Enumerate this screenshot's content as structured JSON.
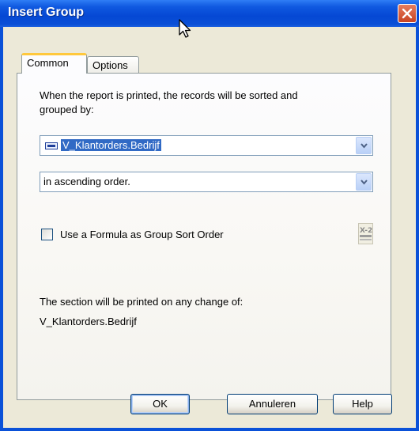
{
  "window": {
    "title": "Insert Group"
  },
  "tabs": [
    {
      "label": "Common",
      "active": true
    },
    {
      "label": "Options",
      "active": false
    }
  ],
  "common": {
    "instruction_line1": "When the report is printed, the records will be sorted and",
    "instruction_line2": "grouped by:",
    "group_field": {
      "value": "V_Klantorders.Bedrijf",
      "icon": "database-field-icon"
    },
    "sort_order": {
      "value": "in ascending order."
    },
    "formula_checkbox": {
      "label": "Use a Formula as Group Sort Order",
      "checked": false
    },
    "formula_button": {
      "icon": "formula-editor-icon",
      "glyph": "X-2"
    },
    "section_info_line1": "The section will be printed on any change of:",
    "section_info_line2": "V_Klantorders.Bedrijf"
  },
  "buttons": {
    "ok": "OK",
    "cancel": "Annuleren",
    "help": "Help"
  },
  "colors": {
    "titlebar": "#0548d4",
    "selection": "#316ac5",
    "tab_highlight": "#ffc83c",
    "close_button": "#c84322"
  }
}
